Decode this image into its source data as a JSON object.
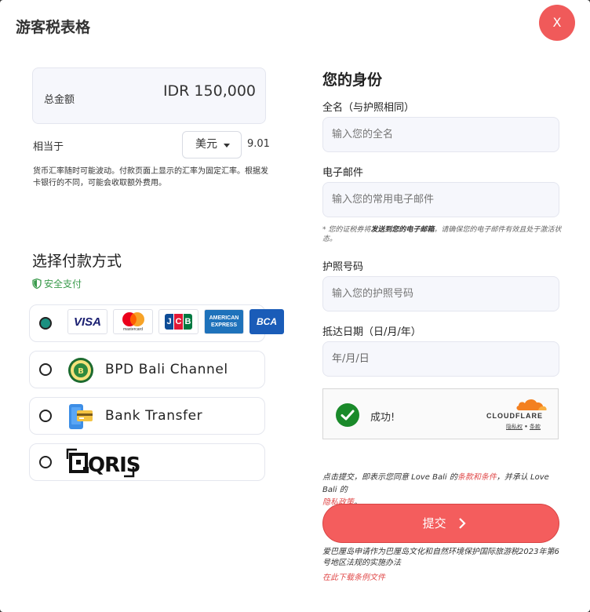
{
  "modal": {
    "title": "游客税表格",
    "close_label": "X"
  },
  "summary": {
    "amount_label": "总金额",
    "amount_value": "IDR 150,000",
    "equiv_label": "相当于",
    "currency": "美元",
    "rate_value": "9.01",
    "fx_note": "货币汇率随时可能波动。付款页面上显示的汇率为固定汇率。根据发卡银行的不同，可能会收取额外费用。"
  },
  "payment": {
    "title": "选择付款方式",
    "secure_label": "安全支付",
    "options": [
      {
        "label": "",
        "selected": true,
        "cards": [
          "VISA",
          "mastercard",
          "JCB",
          "AMERICAN EXPRESS",
          "BCA"
        ]
      },
      {
        "label": "BPD Bali Channel",
        "selected": false
      },
      {
        "label": "Bank Transfer",
        "selected": false
      },
      {
        "label": "QRIS",
        "selected": false
      }
    ]
  },
  "identity": {
    "title": "您的身份",
    "fullname_label": "全名（与护照相同）",
    "fullname_placeholder": "输入您的全名",
    "email_label": "电子邮件",
    "email_placeholder": "输入您的常用电子邮件",
    "email_hint_prefix": "* 您的证税券将",
    "email_hint_bold": "发送到您的电子邮箱",
    "email_hint_suffix": "。请确保您的电子邮件有效且处于激活状态。",
    "passport_label": "护照号码",
    "passport_placeholder": "输入您的护照号码",
    "arrival_label": "抵达日期（日/月/年）",
    "arrival_placeholder": "年/月/日"
  },
  "captcha": {
    "status": "成功!",
    "brand": "CLOUDFLARE",
    "privacy_link": "隐私权",
    "separator": "•",
    "terms_link": "条款"
  },
  "terms": {
    "prefix": "点击提交，即表示您同意 Love Bali 的",
    "terms_link": "条款和条件",
    "middle": "，并承认 Love Bali 的",
    "privacy_link": "隐私政策",
    "suffix": "。"
  },
  "submit_label": "提交",
  "footer": {
    "note": "爱巴厘岛申请作为巴厘岛文化和自然环境保护国际旅游税2023年第6号地区法规的实施办法",
    "download_link": "在此下载条例文件"
  },
  "colors": {
    "accent": "#f45d5d",
    "secure_green": "#3a9a4c",
    "radio_selected": "#1a9080"
  }
}
